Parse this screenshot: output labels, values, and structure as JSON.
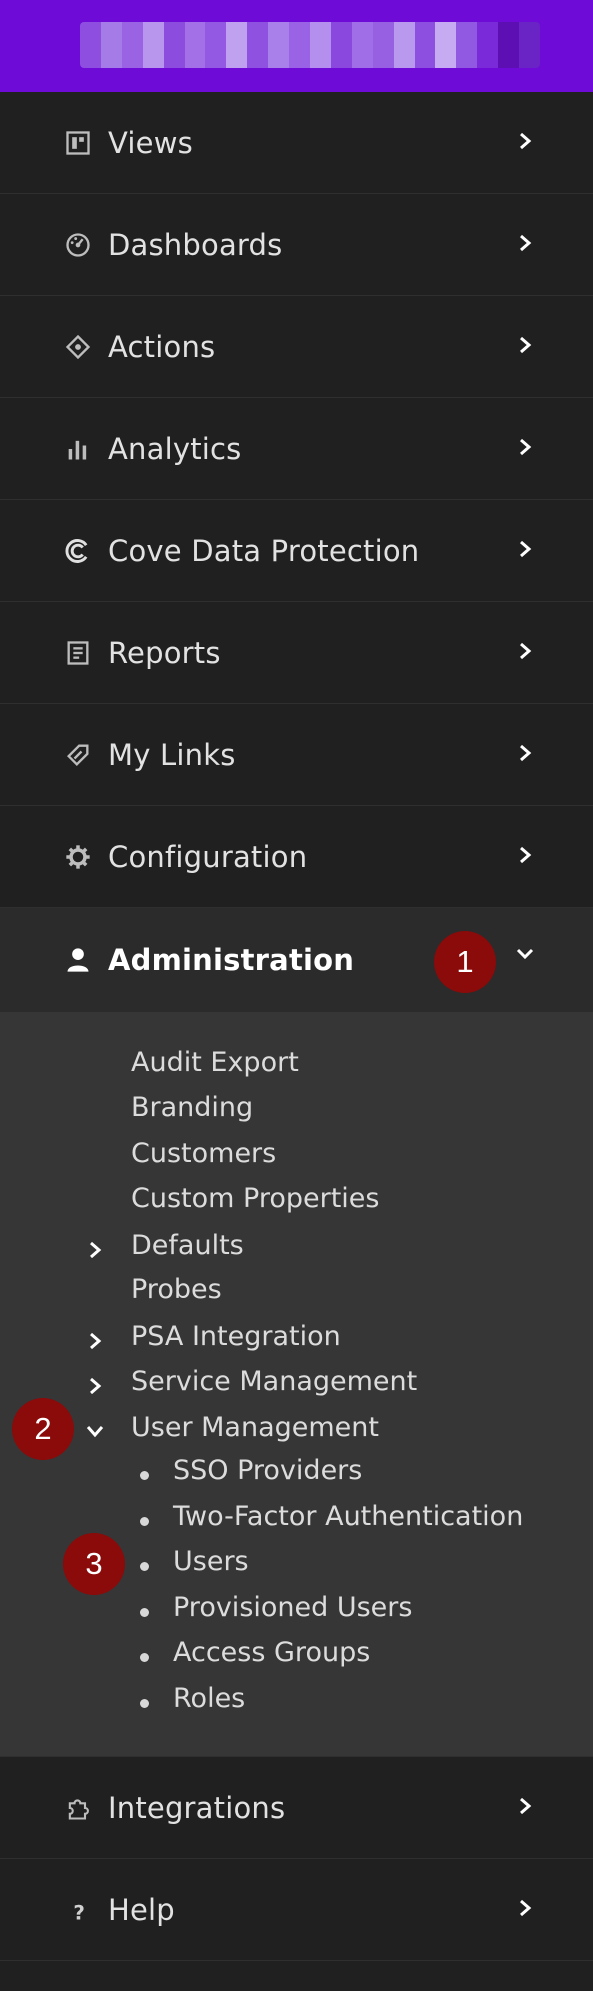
{
  "nav": {
    "items": [
      {
        "label": "Views",
        "icon": "views-icon"
      },
      {
        "label": "Dashboards",
        "icon": "dashboard-icon"
      },
      {
        "label": "Actions",
        "icon": "actions-icon"
      },
      {
        "label": "Analytics",
        "icon": "analytics-icon"
      },
      {
        "label": "Cove Data Protection",
        "icon": "cove-icon"
      },
      {
        "label": "Reports",
        "icon": "reports-icon"
      },
      {
        "label": "My Links",
        "icon": "link-icon"
      },
      {
        "label": "Configuration",
        "icon": "gear-icon"
      },
      {
        "label": "Administration",
        "icon": "user-icon",
        "expanded": true
      },
      {
        "label": "Integrations",
        "icon": "puzzle-icon"
      },
      {
        "label": "Help",
        "icon": "help-icon"
      }
    ]
  },
  "admin_submenu": {
    "items": [
      {
        "label": "Audit Export"
      },
      {
        "label": "Branding"
      },
      {
        "label": "Customers"
      },
      {
        "label": "Custom Properties"
      },
      {
        "label": "Defaults",
        "collapsible": "collapsed"
      },
      {
        "label": "Probes"
      },
      {
        "label": "PSA Integration",
        "collapsible": "collapsed"
      },
      {
        "label": "Service Management",
        "collapsible": "collapsed"
      },
      {
        "label": "User Management",
        "collapsible": "expanded"
      }
    ],
    "user_management": [
      {
        "label": "SSO Providers"
      },
      {
        "label": "Two-Factor Authentication"
      },
      {
        "label": "Users"
      },
      {
        "label": "Provisioned Users"
      },
      {
        "label": "Access Groups"
      },
      {
        "label": "Roles"
      }
    ]
  },
  "annotations": {
    "step1": "1",
    "step2": "2",
    "step3": "3"
  },
  "colors": {
    "topbar": "#6e0bd6",
    "badge": "#8b0a0a",
    "nav_bg": "#202020",
    "submenu_bg": "#363636"
  }
}
